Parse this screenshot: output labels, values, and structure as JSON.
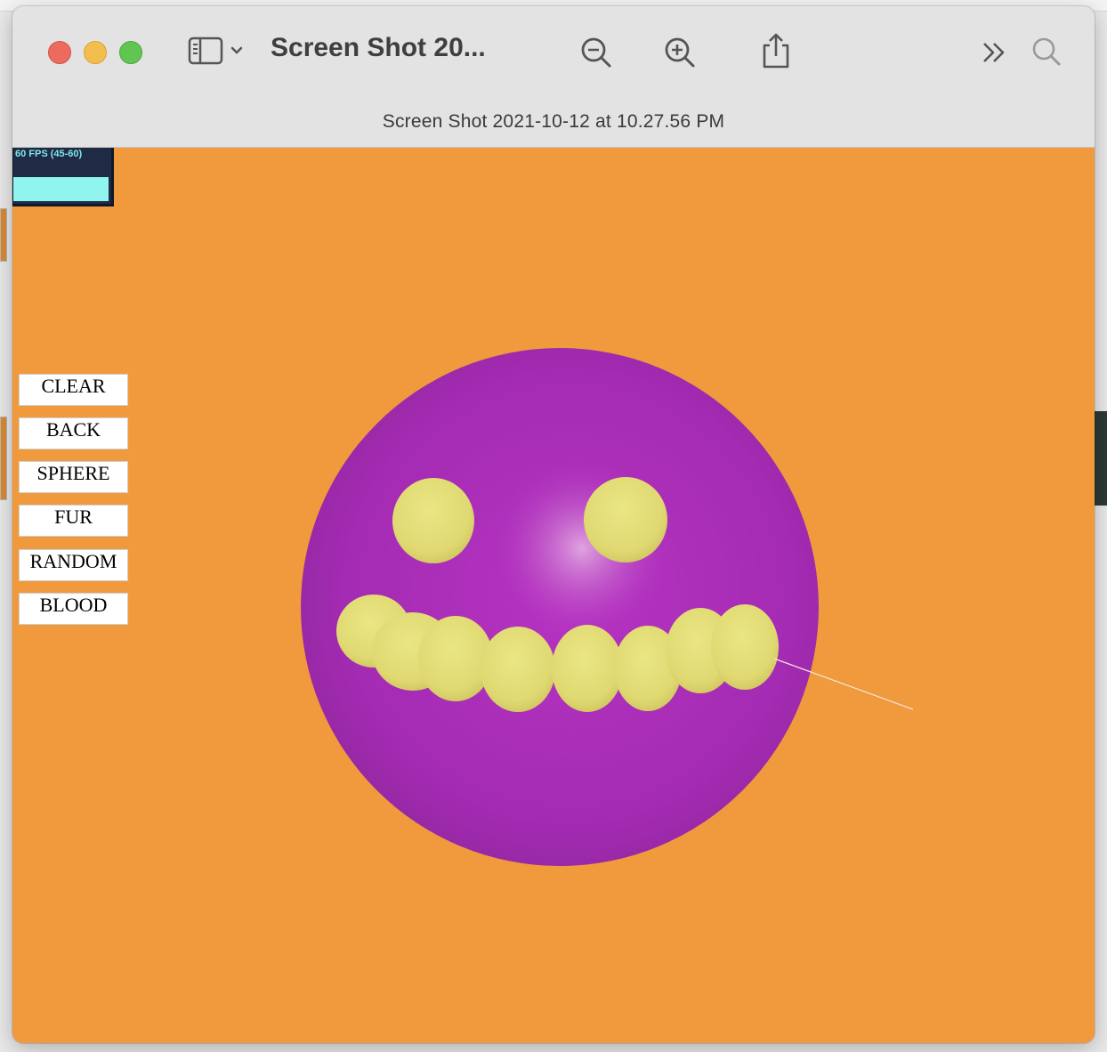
{
  "window": {
    "title_short": "Screen Shot 20...",
    "title_full": "Screen Shot 2021-10-12 at 10.27.56 PM"
  },
  "toolbar": {
    "sidebar_toggle_icon": "sidebar-icon",
    "zoom_out_icon": "zoom-out-icon",
    "zoom_in_icon": "zoom-in-icon",
    "share_icon": "share-icon",
    "more_icon": "chevron-double-right-icon",
    "search_icon": "search-icon"
  },
  "stats": {
    "fps_label": "60 FPS (45-60)"
  },
  "menu": {
    "buttons": [
      "CLEAR",
      "BACK",
      "SPHERE",
      "FUR",
      "RANDOM",
      "BLOOD"
    ]
  },
  "colors": {
    "background": "#f09a3d",
    "sphere": "#a62ab5",
    "blobs": "#e2dc75"
  }
}
